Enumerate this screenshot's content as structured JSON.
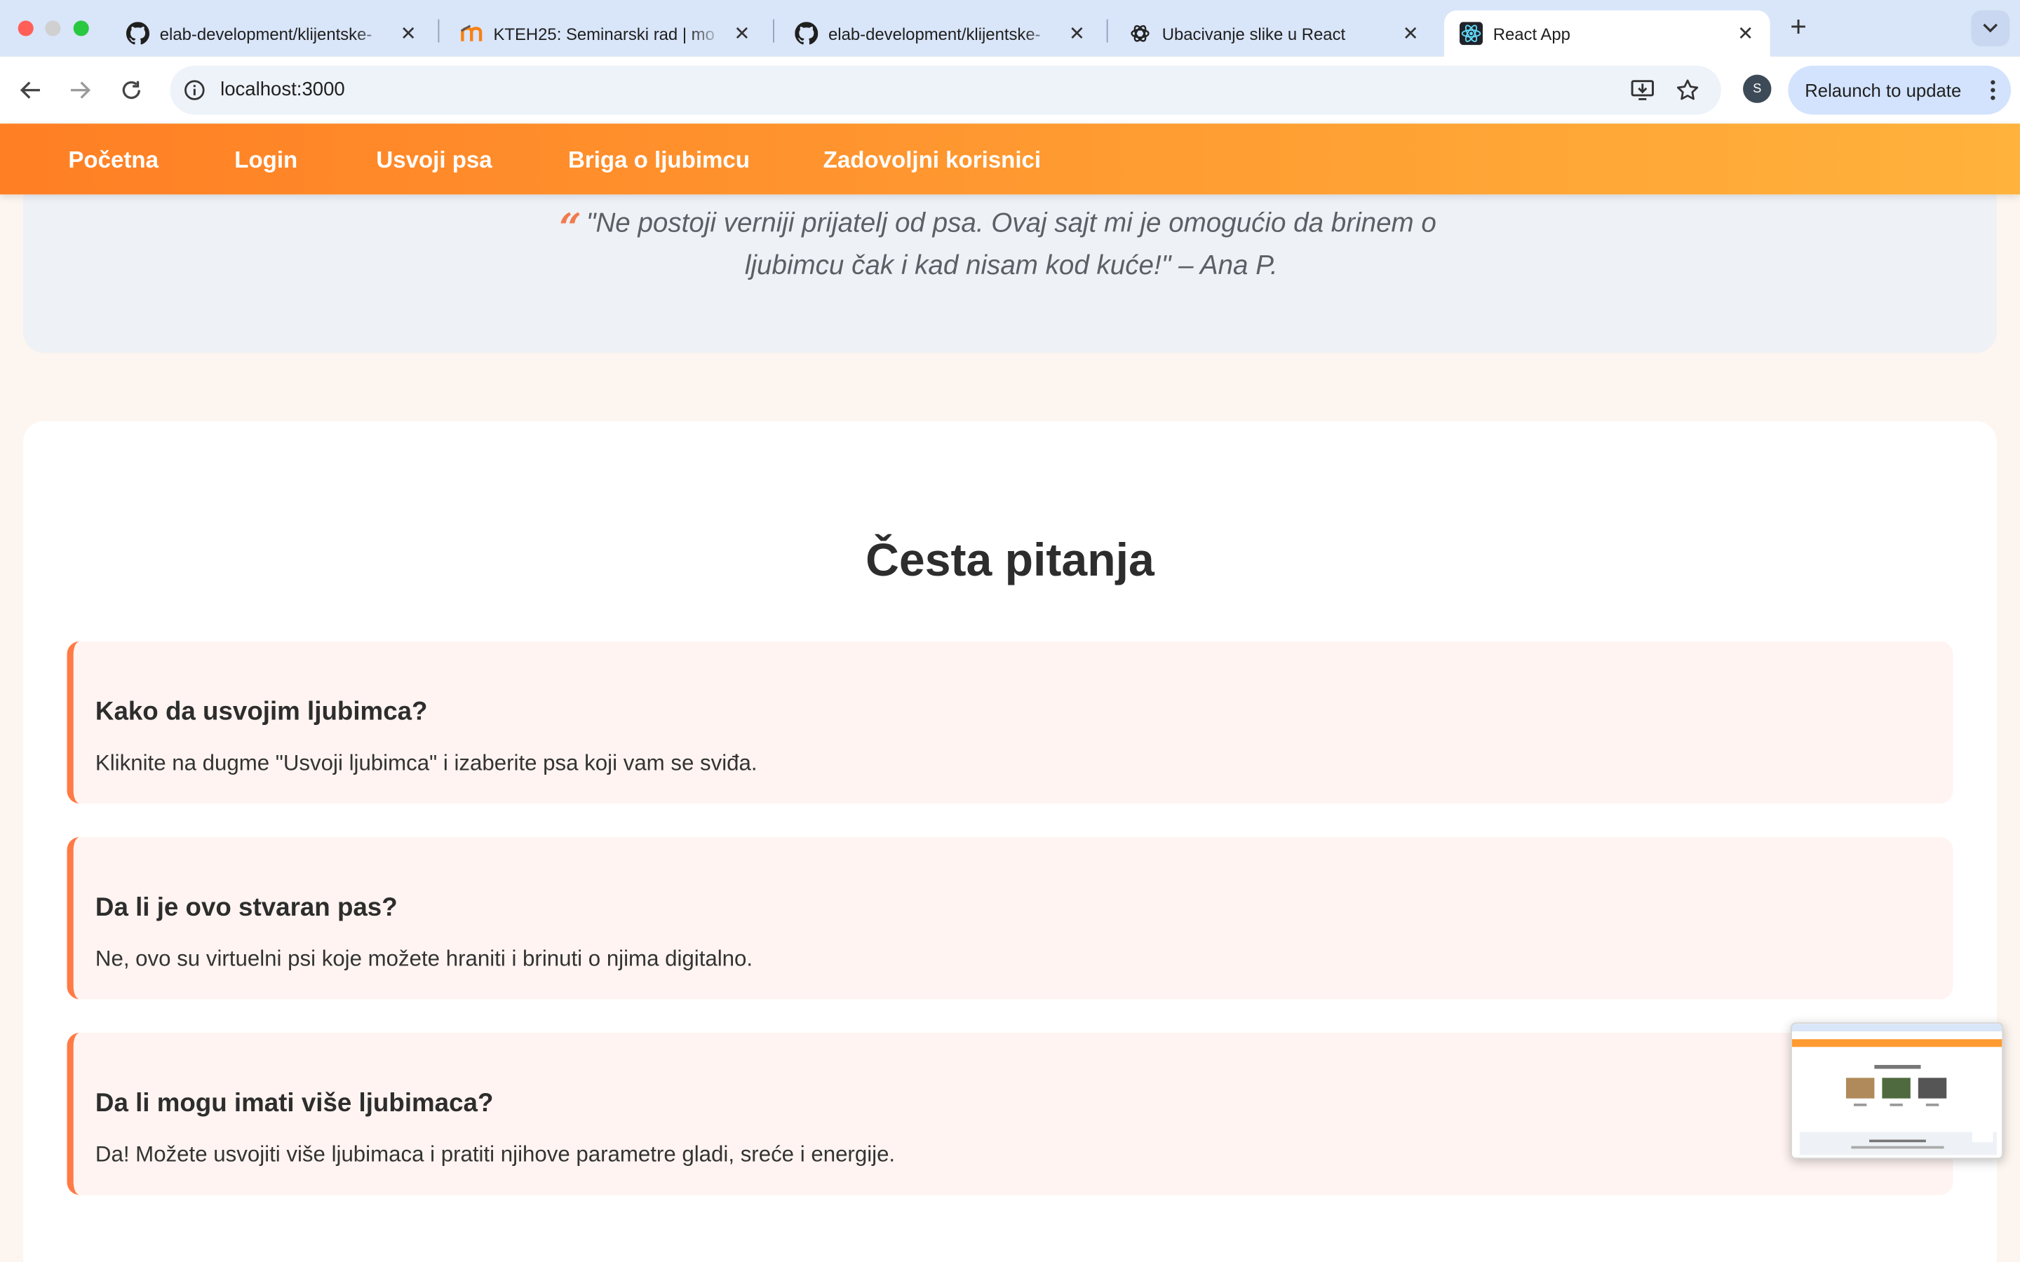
{
  "browser": {
    "tabs": [
      {
        "title": "elab-development/klijentske-",
        "favicon": "github-icon"
      },
      {
        "title": "KTEH25: Seminarski rad | mo",
        "favicon": "moodle-icon"
      },
      {
        "title": "elab-development/klijentske-",
        "favicon": "github-icon"
      },
      {
        "title": "Ubacivanje slike u React",
        "favicon": "openai-icon"
      },
      {
        "title": "React App",
        "favicon": "react-icon",
        "active": true
      }
    ],
    "url": "localhost:3000",
    "profile_initial": "S",
    "relaunch_label": "Relaunch to update"
  },
  "nav": {
    "items": [
      "Početna",
      "Login",
      "Usvoji psa",
      "Briga o ljubimcu",
      "Zadovoljni korisnici"
    ]
  },
  "testimonial": {
    "quote_mark": "“",
    "text": "\"Ne postoji verniji prijatelj od psa. Ovaj sajt mi je omogućio da brinem o ljubimcu čak i kad nisam kod kuće!\" – Ana P."
  },
  "faq": {
    "title": "Česta pitanja",
    "items": [
      {
        "question": "Kako da usvojim ljubimca?",
        "answer": "Kliknite na dugme \"Usvoji ljubimca\" i izaberite psa koji vam se sviđa."
      },
      {
        "question": "Da li je ovo stvaran pas?",
        "answer": "Ne, ovo su virtuelni psi koje možete hraniti i brinuti o njima digitalno."
      },
      {
        "question": "Da li mogu imati više ljubimaca?",
        "answer": "Da! Možete usvojiti više ljubimaca i pratiti njihove parametre gladi, sreće i energije."
      }
    ]
  },
  "colors": {
    "accent": "#ff7a45",
    "nav_gradient_start": "#ff7f24",
    "nav_gradient_end": "#ffb23c"
  }
}
